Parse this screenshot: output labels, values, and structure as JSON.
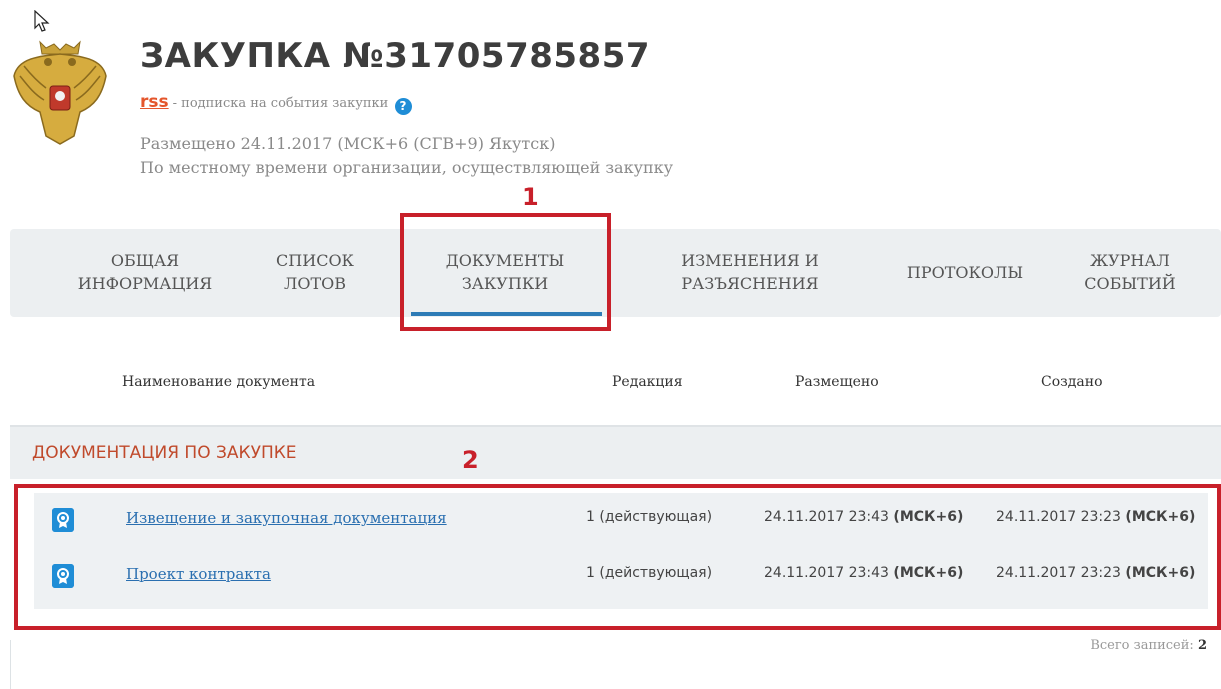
{
  "header": {
    "title": "ЗАКУПКА №31705785857",
    "rss_label": "rss",
    "rss_note": "- подписка на события закупки",
    "help_glyph": "?",
    "posted": "Размещено 24.11.2017 (МСК+6 (СГВ+9) Якутск)",
    "posted_note": "По местному времени организации, осуществляющей закупку"
  },
  "annotations": {
    "marker_1": "1",
    "marker_2": "2",
    "color": "#c8202a"
  },
  "tabs": [
    {
      "line1": "ОБЩАЯ",
      "line2": "ИНФОРМАЦИЯ"
    },
    {
      "line1": "СПИСОК",
      "line2": "ЛОТОВ"
    },
    {
      "line1": "ДОКУМЕНТЫ",
      "line2": "ЗАКУПКИ",
      "active": true
    },
    {
      "line1": "ИЗМЕНЕНИЯ И",
      "line2": "РАЗЪЯСНЕНИЯ"
    },
    {
      "line1": "ПРОТОКОЛЫ",
      "line2": ""
    },
    {
      "line1": "ЖУРНАЛ",
      "line2": "СОБЫТИЙ"
    }
  ],
  "table": {
    "headers": {
      "name": "Наименование документа",
      "revision": "Редакция",
      "posted": "Размещено",
      "created": "Создано"
    },
    "section_title": "ДОКУМЕНТАЦИЯ ПО ЗАКУПКЕ",
    "rows": [
      {
        "icon": "certificate-document-icon",
        "name": "Извещение и закупочная документация",
        "revision": "1 (действующая)",
        "posted": "24.11.2017 23:43",
        "posted_tz": "(МСК+6)",
        "created": "24.11.2017 23:23",
        "created_tz": "(МСК+6)"
      },
      {
        "icon": "certificate-document-icon",
        "name": "Проект контракта",
        "revision": "1 (действующая)",
        "posted": "24.11.2017 23:43",
        "posted_tz": "(МСК+6)",
        "created": "24.11.2017 23:23",
        "created_tz": "(МСК+6)"
      }
    ],
    "total_label": "Всего записей:",
    "total_count": "2"
  },
  "colors": {
    "accent": "#2d7bb6",
    "rss": "#e4562c",
    "section_title": "#c04a2c"
  }
}
